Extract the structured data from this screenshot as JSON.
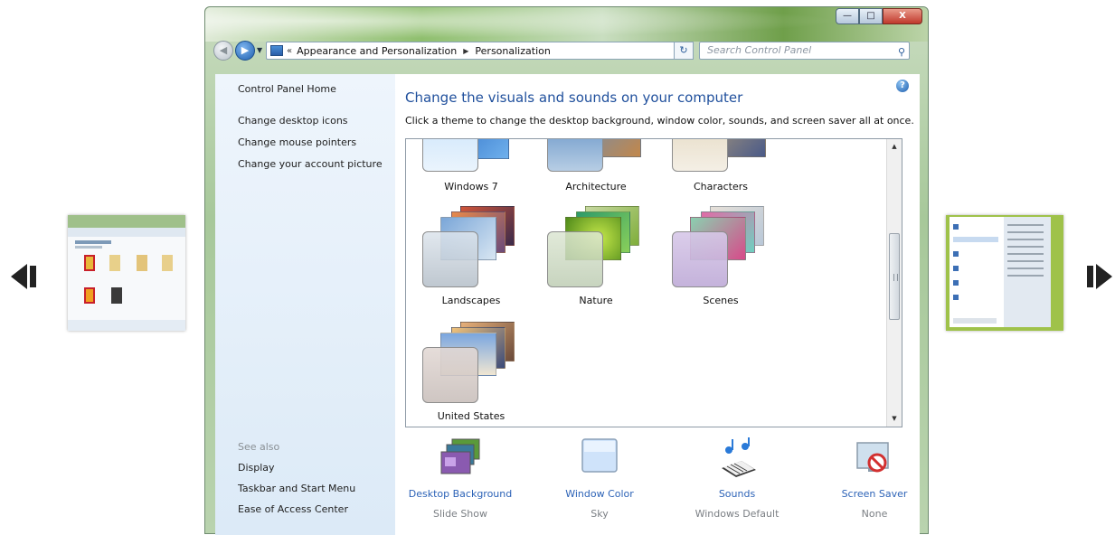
{
  "window": {
    "address": {
      "crumbs": [
        "Appearance and Personalization",
        "Personalization"
      ]
    },
    "search": {
      "placeholder": "Search Control Panel"
    },
    "captions": {
      "minimize": "—",
      "maximize": "□",
      "close": "X"
    }
  },
  "sidebar": {
    "home": "Control Panel Home",
    "links": [
      "Change desktop icons",
      "Change mouse pointers",
      "Change your account picture"
    ],
    "see_also_title": "See also",
    "see_also": [
      "Display",
      "Taskbar and Start Menu",
      "Ease of Access Center"
    ]
  },
  "main": {
    "title": "Change the visuals and sounds on your computer",
    "subtitle": "Click a theme to change the desktop background, window color, sounds, and screen saver all at once.",
    "themes": [
      {
        "label": "Windows 7"
      },
      {
        "label": "Architecture"
      },
      {
        "label": "Characters"
      },
      {
        "label": "Landscapes"
      },
      {
        "label": "Nature"
      },
      {
        "label": "Scenes"
      },
      {
        "label": "United States"
      }
    ],
    "bottom": [
      {
        "title": "Desktop Background",
        "sub": "Slide Show"
      },
      {
        "title": "Window Color",
        "sub": "Sky"
      },
      {
        "title": "Sounds",
        "sub": "Windows Default"
      },
      {
        "title": "Screen Saver",
        "sub": "None"
      }
    ]
  },
  "colors": {
    "link_blue": "#2d63b7",
    "title_blue": "#1f4f9c",
    "pane_blue": "#dceaf7"
  }
}
